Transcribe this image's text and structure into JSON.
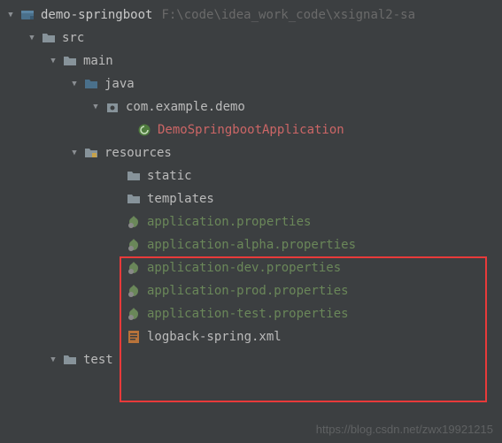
{
  "project": {
    "name": "demo-springboot",
    "path": "F:\\code\\idea_work_code\\xsignal2-sa"
  },
  "tree": {
    "src": "src",
    "main": "main",
    "java": "java",
    "package": "com.example.demo",
    "mainClass": "DemoSpringbootApplication",
    "resources": "resources",
    "static": "static",
    "templates": "templates",
    "propFiles": [
      "application.properties",
      "application-alpha.properties",
      "application-dev.properties",
      "application-prod.properties",
      "application-test.properties"
    ],
    "logback": "logback-spring.xml",
    "test": "test"
  },
  "watermark": "https://blog.csdn.net/zwx19921215"
}
